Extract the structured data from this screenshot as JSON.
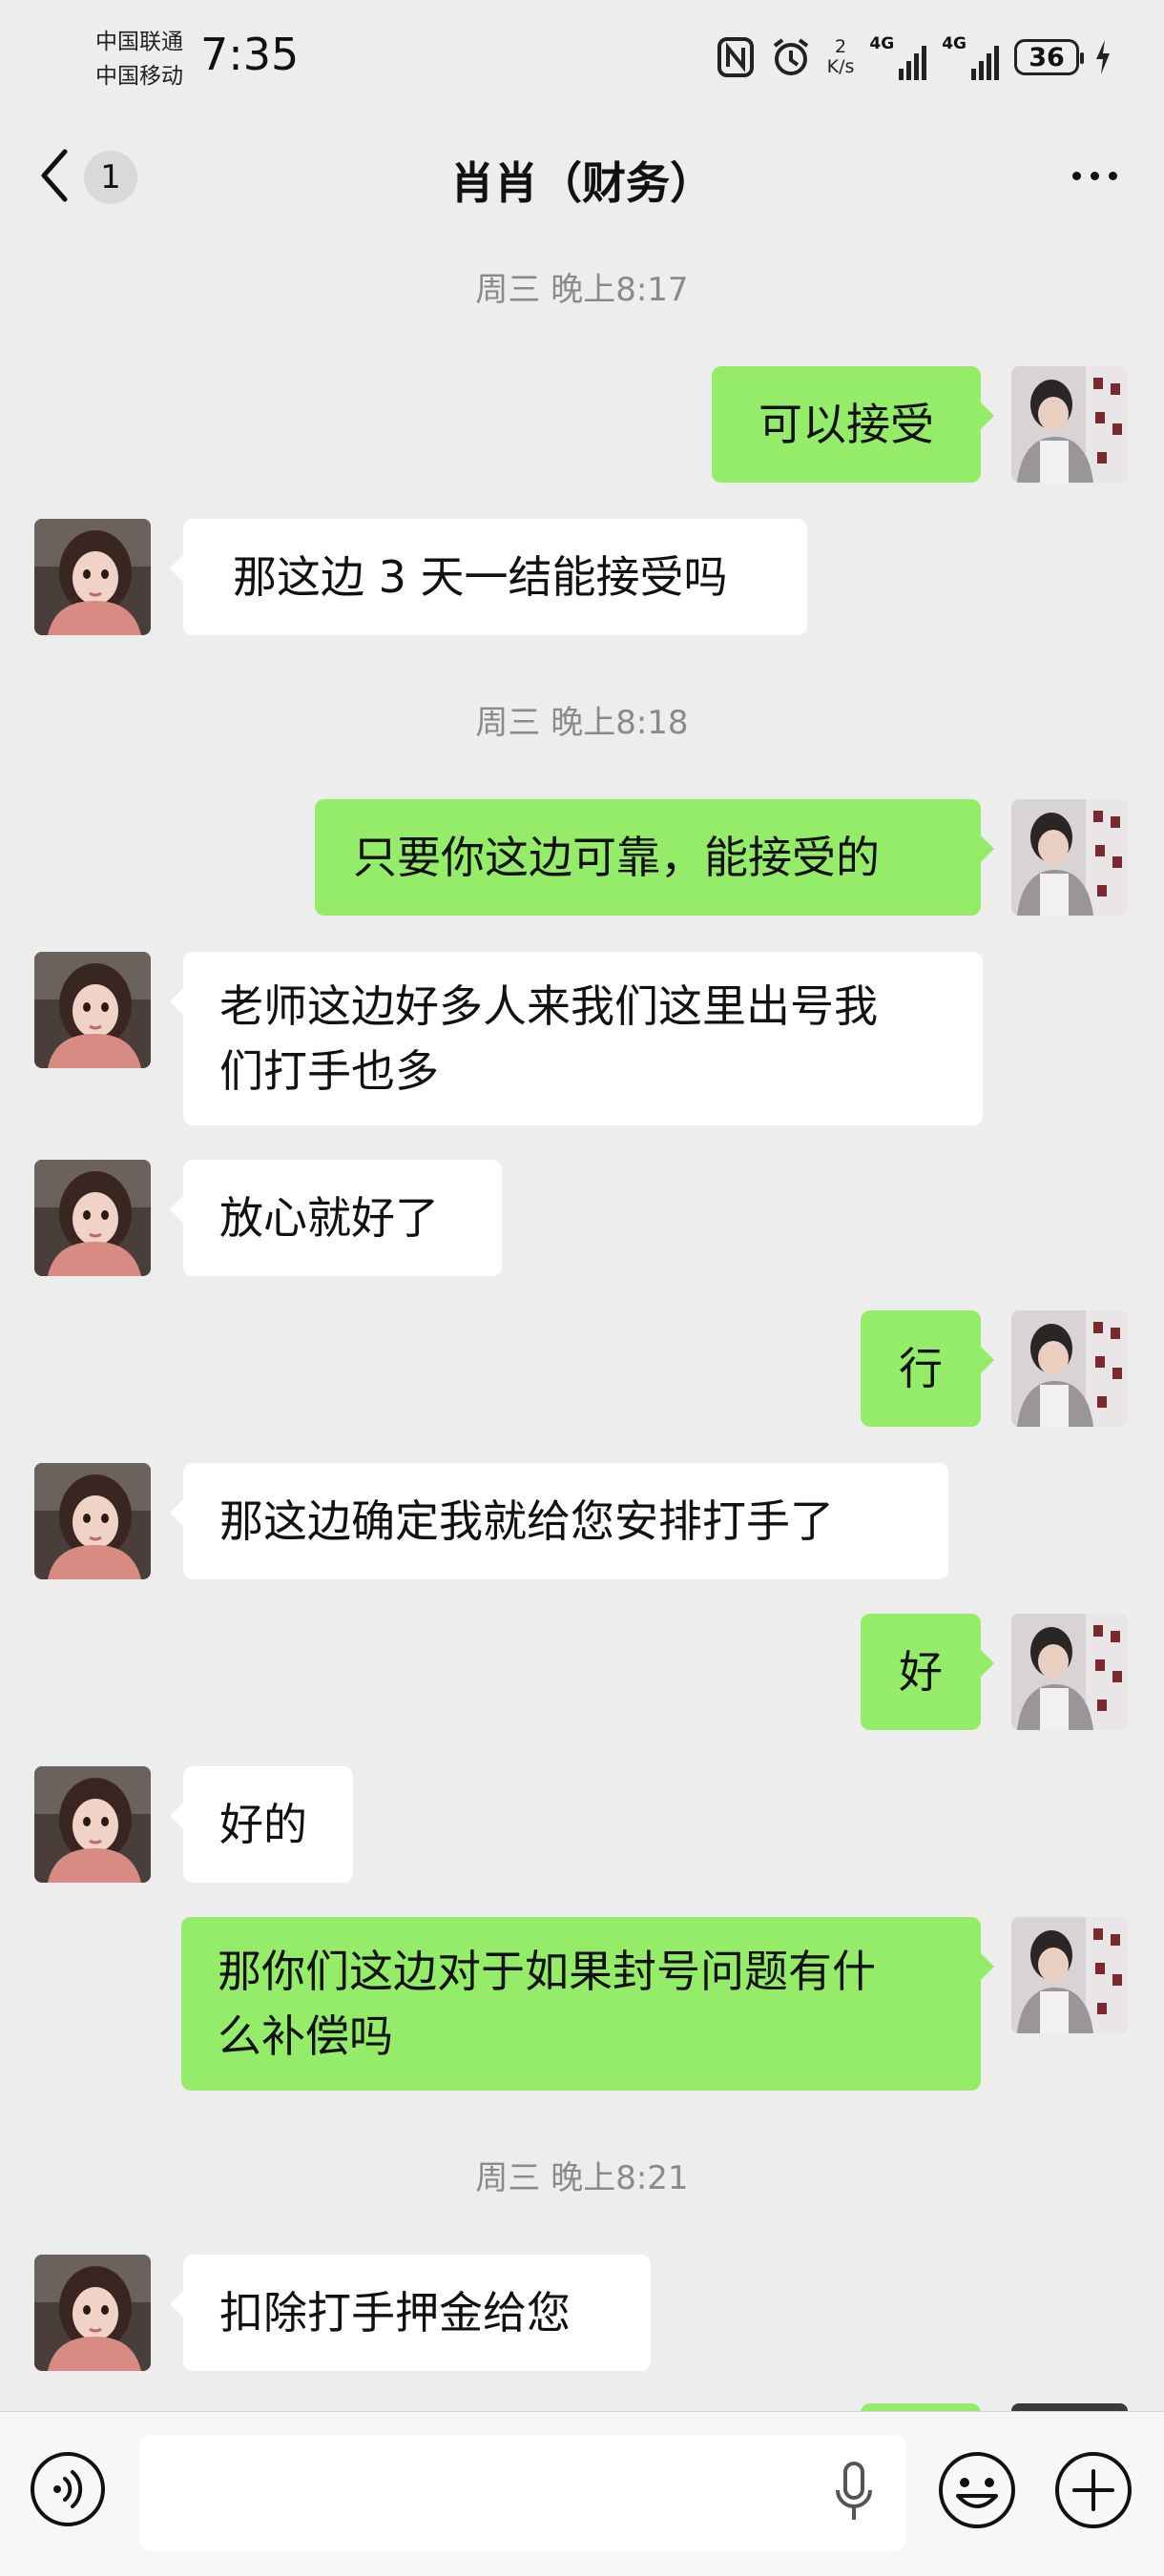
{
  "status_bar": {
    "carrier_1": "中国联通",
    "carrier_2": "中国移动",
    "time": "7:35",
    "speed_value": "2",
    "speed_unit": "K/s",
    "net_1": "4G",
    "net_2": "4G",
    "battery": "36"
  },
  "header": {
    "unread_count": "1",
    "title": "肖肖（财务）"
  },
  "messages": [
    {
      "kind": "time",
      "text": "周三 晚上8:17"
    },
    {
      "kind": "out",
      "text": "可以接受"
    },
    {
      "kind": "in",
      "text": "那这边 3 天一结能接受吗"
    },
    {
      "kind": "time",
      "text": "周三 晚上8:18"
    },
    {
      "kind": "out",
      "text": "只要你这边可靠，能接受的"
    },
    {
      "kind": "in",
      "line1": "老师这边好多人来我们这里出号我",
      "line2": "们打手也多"
    },
    {
      "kind": "in",
      "text": "放心就好了"
    },
    {
      "kind": "out",
      "text": "行"
    },
    {
      "kind": "in",
      "text": "那这边确定我就给您安排打手了"
    },
    {
      "kind": "out",
      "text": "好"
    },
    {
      "kind": "in",
      "text": "好的"
    },
    {
      "kind": "out",
      "line1": "那你们这边对于如果封号问题有什",
      "line2": "么补偿吗"
    },
    {
      "kind": "time",
      "text": "周三 晚上8:21"
    },
    {
      "kind": "in",
      "text": "扣除打手押金给您"
    }
  ],
  "colors": {
    "background": "#ededed",
    "outgoing_bubble": "#95ec69",
    "incoming_bubble": "#ffffff",
    "timestamp_text": "#8a8a8a"
  },
  "icons": {
    "back": "chevron-left-icon",
    "more": "more-dots-icon",
    "voice": "voice-icon",
    "mic": "microphone-icon",
    "emoji": "emoji-icon",
    "plus": "plus-icon"
  }
}
